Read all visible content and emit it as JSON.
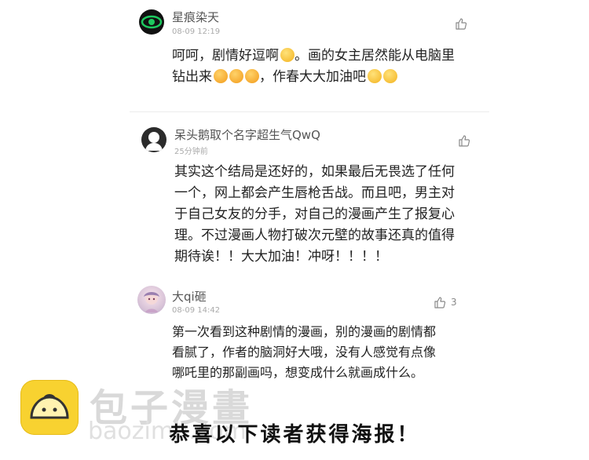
{
  "comments": [
    {
      "username": "星痕染天",
      "time": "08-09 12:19",
      "likes": "",
      "lines": [
        "呵呵，剧情好逗啊",
        "。画的女主居然能从电脑里",
        "钻出来",
        "，作春大大加油吧"
      ]
    },
    {
      "username": "呆头鹅取个名字超生气QwQ",
      "time": "25分钟前",
      "likes": "",
      "lines": [
        "其实这个结局是还好的，如果最后无畏选了任何",
        "一个，网上都会产生唇枪舌战。而且吧，男主对",
        "于自己女友的分手，对自己的漫画产生了报复心",
        "理。不过漫画人物打破次元壁的故事还真的值得",
        "期待诶！！大大加油！冲呀！！！！"
      ]
    },
    {
      "username": "大qi砸",
      "time": "08-09 14:42",
      "likes": "3",
      "lines": [
        "第一次看到这种剧情的漫画，别的漫画的剧情都",
        "看腻了，作者的脑洞好大哦，没有人感觉有点像",
        "哪吒里的那副画吗，想变成什么就画成什么。"
      ]
    }
  ],
  "watermark": {
    "name": "包子漫畫",
    "url": "baozimh.com"
  },
  "banner": "恭喜以下读者获得海报！",
  "colors": {
    "accent_green": "#1ec95f",
    "logo_yellow": "#f8d230",
    "text": "#222222",
    "muted": "#aaaaaa"
  }
}
